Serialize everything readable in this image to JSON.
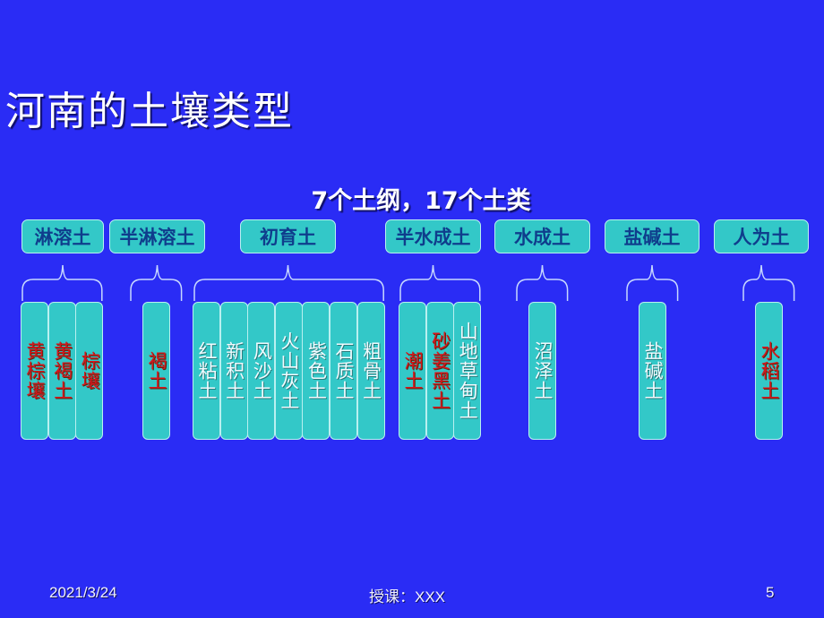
{
  "slide": {
    "title": "河南的土壤类型",
    "subtitle": "7个土纲，17个土类",
    "categories": [
      {
        "label": "淋溶土",
        "soils": [
          {
            "label": "黄棕壤",
            "color": "red"
          },
          {
            "label": "黄褐土",
            "color": "red"
          },
          {
            "label": "棕壤",
            "color": "red"
          }
        ]
      },
      {
        "label": "半淋溶土",
        "soils": [
          {
            "label": "褐土",
            "color": "red"
          }
        ]
      },
      {
        "label": "初育土",
        "soils": [
          {
            "label": "红粘土",
            "color": "white"
          },
          {
            "label": "新积土",
            "color": "white"
          },
          {
            "label": "风沙土",
            "color": "white"
          },
          {
            "label": "火山灰土",
            "color": "white"
          },
          {
            "label": "紫色土",
            "color": "white"
          },
          {
            "label": "石质土",
            "color": "white"
          },
          {
            "label": "粗骨土",
            "color": "white"
          }
        ]
      },
      {
        "label": "半水成土",
        "soils": [
          {
            "label": "潮土",
            "color": "red"
          },
          {
            "label": "砂姜黑土",
            "color": "red"
          },
          {
            "label": "山地草甸土",
            "color": "white"
          }
        ]
      },
      {
        "label": "水成土",
        "soils": [
          {
            "label": "沼泽土",
            "color": "white"
          }
        ]
      },
      {
        "label": "盐碱土",
        "soils": [
          {
            "label": "盐碱土",
            "color": "white"
          }
        ]
      },
      {
        "label": "人为土",
        "soils": [
          {
            "label": "水稻土",
            "color": "red"
          }
        ]
      }
    ],
    "colors": {
      "background": "#2a2cf5",
      "box_fill": "#33c8c8",
      "box_border": "#b9f0f0",
      "category_text": "#0f3d8c",
      "highlight_text": "#d6161c",
      "normal_text": "#f2fbff"
    }
  },
  "footer": {
    "date": "2021/3/24",
    "presenter": "授课：XXX",
    "page_number": "5"
  }
}
